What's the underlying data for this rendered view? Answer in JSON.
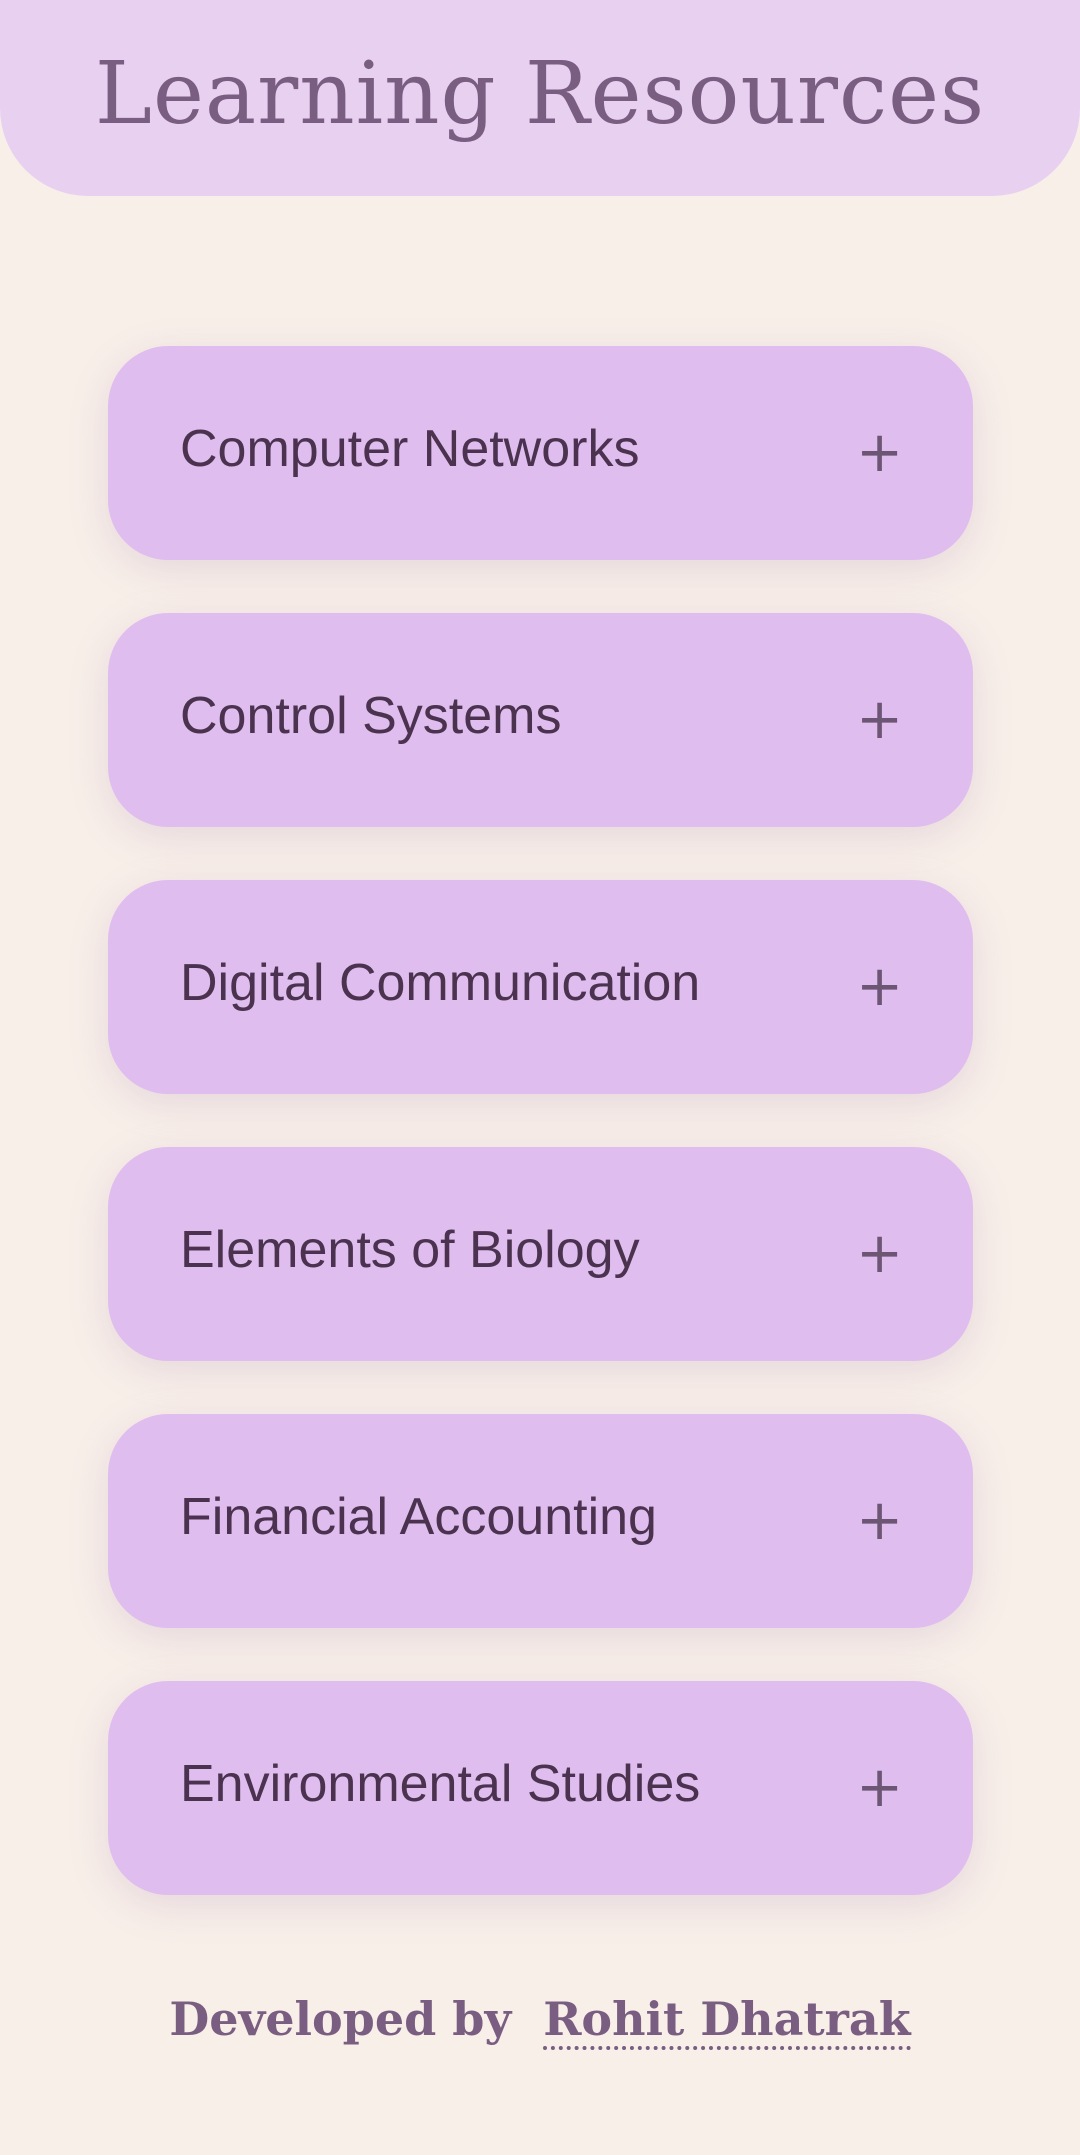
{
  "header": {
    "title": "Learning Resources"
  },
  "subjects": [
    {
      "label": "Computer Networks",
      "icon": "+"
    },
    {
      "label": "Control Systems",
      "icon": "+"
    },
    {
      "label": "Digital Communication",
      "icon": "+"
    },
    {
      "label": "Elements of Biology",
      "icon": "+"
    },
    {
      "label": "Financial Accounting",
      "icon": "+"
    },
    {
      "label": "Environmental Studies",
      "icon": "+"
    }
  ],
  "footer": {
    "prefix": "Developed by",
    "author": "Rohit Dhatrak"
  },
  "colors": {
    "background": "#f8efe9",
    "header": "#e8d0f0",
    "card": "#e0bdef",
    "title_text": "#7a5e82",
    "card_text": "#4b3350"
  }
}
